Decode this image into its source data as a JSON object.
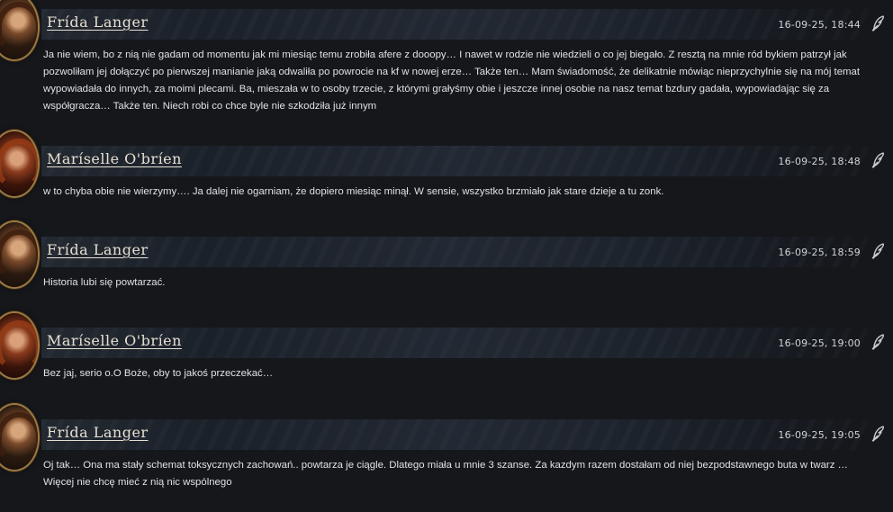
{
  "posts": [
    {
      "author": "Frída Langer",
      "avatar": "frida",
      "timestamp": "16-09-25, 18:44",
      "message": "Ja nie wiem, bo z nią nie gadam od momentu jak mi miesiąc temu zrobiła afere z dooopy… I nawet w rodzie nie wiedzieli o co jej biegało. Z resztą na mnie ród bykiem patrzył jak pozwoliłam jej dołączyć po pierwszej manianie jaką odwaliła po powrocie na kf w nowej erze… Także ten… Mam świadomość, że delikatnie mówiąc nieprzychylnie się na mój temat wypowiadała do innych, za moimi plecami. Ba, mieszała w to osoby trzecie, z którymi grałyśmy obie i jeszcze innej osobie na nasz temat bzdury gadała, wypowiadając się za współgracza… Także ten. Niech robi co chce byle nie szkodziła już innym"
    },
    {
      "author": "Maríselle O'bríen",
      "avatar": "mariselle",
      "timestamp": "16-09-25, 18:48",
      "message": "w to chyba obie nie wierzymy…. Ja dalej nie ogarniam, że dopiero miesiąc minął. W sensie, wszystko brzmiało jak stare dzieje a tu zonk."
    },
    {
      "author": "Frída Langer",
      "avatar": "frida",
      "timestamp": "16-09-25, 18:59",
      "message": "Historia lubi się powtarzać."
    },
    {
      "author": "Maríselle O'bríen",
      "avatar": "mariselle",
      "timestamp": "16-09-25, 19:00",
      "message": "Bez jaj, serio o.O Boże, oby to jakoś przeczekać…"
    },
    {
      "author": "Frída Langer",
      "avatar": "frida",
      "timestamp": "16-09-25, 19:05",
      "message": "Oj tak… Ona ma stały schemat toksycznych zachowań.. powtarza je ciągle. Dlatego miała u mnie 3 szanse. Za kazdym razem dostałam od niej bezpodstawnego buta w twarz … Więcej nie chcę mieć z nią nic wspólnego"
    }
  ],
  "icons": {
    "quote": "quill-icon"
  }
}
